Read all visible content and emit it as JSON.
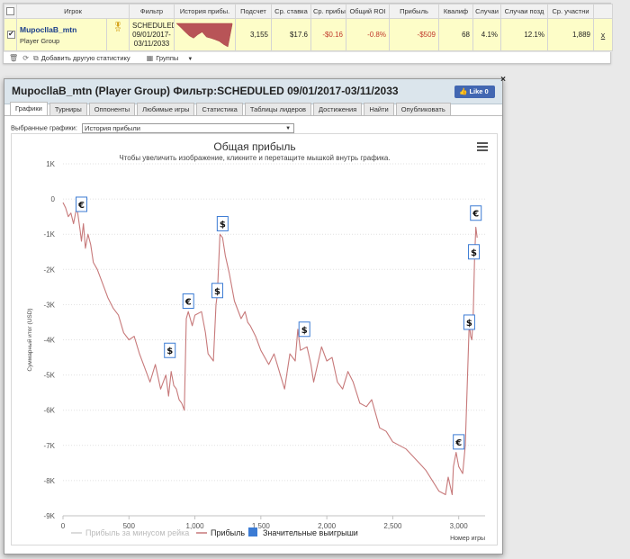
{
  "table": {
    "headers": [
      "Игрок",
      "Фильтр",
      "История прибы.",
      "Подсчет",
      "Ср. ставка",
      "Ср. прибы",
      "Общий ROI",
      "Прибыль",
      "Квалиф",
      "Случаи",
      "Случаи позд",
      "Ср. участни"
    ],
    "row": {
      "player_name": "MupocllaB_mtn",
      "player_group": "Player Group",
      "filter_line1": "SCHEDULED",
      "filter_line2": "09/01/2017-",
      "filter_line3": "03/11/2033",
      "count": "3,155",
      "avg_stake": "$17.6",
      "avg_profit": "-$0.16",
      "roi": "-0.8%",
      "profit": "-$509",
      "qualif": "68",
      "cases": "4.1%",
      "late_cases": "12.1%",
      "avg_entrants": "1,889",
      "remove": "x"
    },
    "sparkline": [
      -0.1,
      -1.5,
      -3.0,
      -4.4,
      -5.2,
      -4.0,
      -3.1,
      -4.8,
      -5.2,
      -5.7,
      -6.3,
      -7.4,
      -8.2,
      -0.5
    ]
  },
  "toolbar": {
    "add_stats": "Добавить другую статистику",
    "groups": "Группы"
  },
  "dialog": {
    "title": "MupocllaB_mtn (Player Group) Фильтр:SCHEDULED 09/01/2017-03/11/2033",
    "like_label": "Like 0",
    "close": "×",
    "tabs": [
      "Графики",
      "Турниры",
      "Оппоненты",
      "Любимые игры",
      "Статистика",
      "Таблицы лидеров",
      "Достижения",
      "Найти",
      "Опубликовать"
    ],
    "select_label": "Выбранные графики:",
    "select_value": "История прибыли"
  },
  "chart_data": {
    "type": "line",
    "title": "Общая прибыль",
    "subtitle": "Чтобы увеличить изображение, кликните и перетащите мышкой внутрь графика.",
    "ylabel": "Суммарный итог (USD)",
    "xlabel": "Номер игры",
    "xlim": [
      0,
      3200
    ],
    "ylim": [
      -9000,
      1000
    ],
    "x_ticks": [
      0,
      500,
      1000,
      1500,
      2000,
      2500,
      3000
    ],
    "x_tick_labels": [
      "0",
      "500",
      "1,000",
      "1,500",
      "2,000",
      "2,500",
      "3,000"
    ],
    "y_ticks": [
      1000,
      0,
      -1000,
      -2000,
      -3000,
      -4000,
      -5000,
      -6000,
      -7000,
      -8000,
      -9000
    ],
    "y_tick_labels": [
      "1K",
      "0",
      "-1K",
      "-2K",
      "-3K",
      "-4K",
      "-5K",
      "-6K",
      "-7K",
      "-8K",
      "-9K"
    ],
    "series": [
      {
        "name": "Прибыль",
        "color": "#c7797a",
        "x": [
          0,
          20,
          40,
          60,
          80,
          100,
          110,
          130,
          140,
          155,
          170,
          190,
          210,
          230,
          260,
          300,
          340,
          380,
          420,
          460,
          500,
          540,
          580,
          620,
          660,
          700,
          740,
          780,
          800,
          820,
          840,
          860,
          880,
          900,
          920,
          935,
          950,
          980,
          1000,
          1050,
          1080,
          1100,
          1140,
          1160,
          1170,
          1190,
          1210,
          1230,
          1260,
          1300,
          1350,
          1380,
          1400,
          1420,
          1460,
          1500,
          1560,
          1600,
          1680,
          1720,
          1760,
          1780,
          1800,
          1850,
          1880,
          1900,
          1960,
          2000,
          2040,
          2080,
          2120,
          2160,
          2200,
          2250,
          2300,
          2340,
          2400,
          2450,
          2500,
          2550,
          2600,
          2650,
          2700,
          2750,
          2800,
          2850,
          2900,
          2920,
          2950,
          2960,
          2980,
          3000,
          3030,
          3050,
          3080,
          3090,
          3100,
          3110,
          3120,
          3130,
          3140
        ],
        "y": [
          -100,
          -250,
          -500,
          -400,
          -700,
          -300,
          -350,
          -900,
          -1200,
          -700,
          -1400,
          -1000,
          -1300,
          -1800,
          -2000,
          -2400,
          -2800,
          -3100,
          -3300,
          -3800,
          -4000,
          -3900,
          -4400,
          -4800,
          -5200,
          -4700,
          -5400,
          -5000,
          -5600,
          -4900,
          -5300,
          -5400,
          -5700,
          -5800,
          -6000,
          -3400,
          -3200,
          -3600,
          -3300,
          -3200,
          -3800,
          -4400,
          -4600,
          -3000,
          -2700,
          -1000,
          -1100,
          -1600,
          -2100,
          -2900,
          -3400,
          -3200,
          -3500,
          -3600,
          -3900,
          -4300,
          -4700,
          -4400,
          -5400,
          -4400,
          -4600,
          -3700,
          -4300,
          -4200,
          -4700,
          -5200,
          -4200,
          -4600,
          -4500,
          -5200,
          -5400,
          -4900,
          -5200,
          -5800,
          -5900,
          -5700,
          -6500,
          -6600,
          -6900,
          -7000,
          -7100,
          -7300,
          -7500,
          -7700,
          -8000,
          -8300,
          -8400,
          -7900,
          -8400,
          -7600,
          -7200,
          -7600,
          -7800,
          -7000,
          -3500,
          -3900,
          -4000,
          -3300,
          -1700,
          -800,
          -1100
        ]
      },
      {
        "name": "Прибыль за минусом рейка",
        "color": "#d9d9d9",
        "x": [],
        "y": []
      }
    ],
    "markers": [
      {
        "x": 140,
        "y": -150,
        "label": "€"
      },
      {
        "x": 810,
        "y": -4300,
        "label": "$"
      },
      {
        "x": 950,
        "y": -2900,
        "label": "€"
      },
      {
        "x": 1170,
        "y": -2600,
        "label": "$"
      },
      {
        "x": 1210,
        "y": -700,
        "label": "$"
      },
      {
        "x": 1830,
        "y": -3700,
        "label": "$"
      },
      {
        "x": 3000,
        "y": -6900,
        "label": "€"
      },
      {
        "x": 3080,
        "y": -3500,
        "label": "$"
      },
      {
        "x": 3115,
        "y": -1500,
        "label": "$"
      },
      {
        "x": 3130,
        "y": -400,
        "label": "€"
      }
    ],
    "legend": {
      "position": "bottom",
      "items": [
        {
          "name": "Прибыль за минусом рейка",
          "color": "#cfcfcf"
        },
        {
          "name": "Прибыль",
          "color": "#c7797a"
        },
        {
          "name": "Значительные выигрыши",
          "color": "#3b7bd4"
        }
      ]
    },
    "grid": true
  }
}
